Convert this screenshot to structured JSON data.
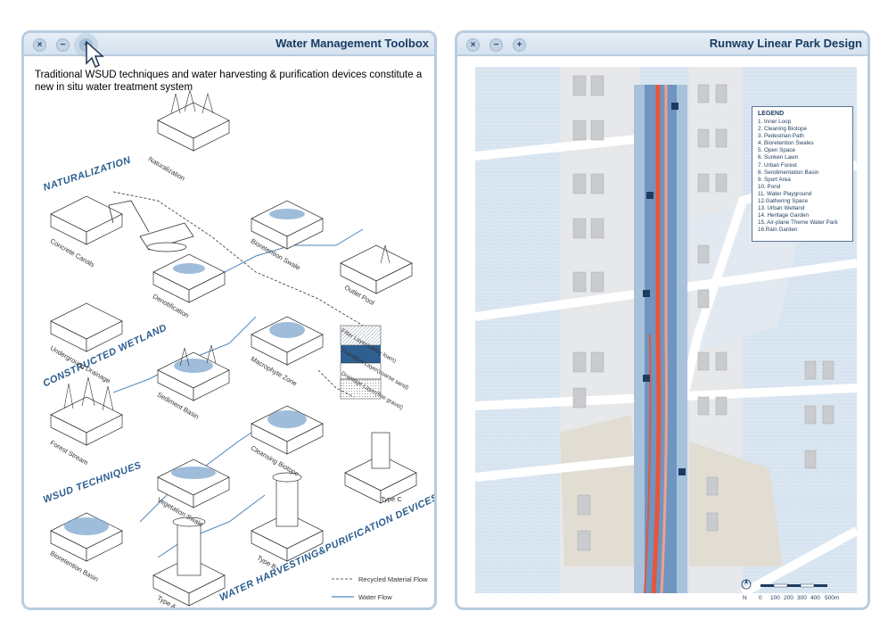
{
  "left_window": {
    "title": "Water Management Toolbox",
    "intro": "Traditional WSUD techniques and water harvesting & purification devices constitute a new in situ water treatment system",
    "sections": {
      "naturalization": "NATURALIZATION",
      "constructed_wetland": "CONSTRUCTED WETLAND",
      "wsud": "WSUD TECHNIQUES",
      "harvesting": "WATER HARVESTING&PURIFICATION DEVICES"
    },
    "blocks": {
      "naturalization": "Naturalization",
      "concrete_canals": "Concrete Canals",
      "bioretention_swale": "Bioretention Swale",
      "denotification": "Denotification",
      "outlet_pool": "Outlet Pool",
      "underground_drainage": "Underground Drainage",
      "macrophyte_zone": "Macrophyte Zone",
      "sediment_basin": "Sediment Basin",
      "forest_stream": "Forest Stream",
      "cleansing_biotope": "Cleansing Biotope",
      "vegetation_swale": "Vegetation Swale",
      "bioretention_basin": "Bioretention Basin",
      "type_a": "Type A",
      "type_b": "Type B",
      "type_c": "Type C"
    },
    "layers": {
      "filter": "Filter Layer(sandy loam)",
      "transition": "Transition Layer(coarse sand)",
      "drainage": "Drainage Layer(fine gravel)"
    },
    "legend": {
      "recycled": "Recycled Material Flow",
      "water": "Water Flow"
    }
  },
  "right_window": {
    "title": "Runway Linear Park Design",
    "legend_title": "LEGEND",
    "legend_items": [
      "1. Inner Loop",
      "2. Cleaning Biotope",
      "3. Pedestrian Path",
      "4. Bioretention Swales",
      "5. Open Space",
      "6. Sunken Lawn",
      "7. Urban Forest",
      "8. Sendimentation Basin",
      "9. Sport Area",
      "10. Pond",
      "11. Water Playground",
      "12.Gathering Space",
      "13. Urban Wetland",
      "14. Heritage Garden",
      "15. Air-plane Theme Water Park",
      "16.Rain Garden"
    ],
    "north": "N",
    "scale": [
      "0",
      "100",
      "200",
      "300",
      "400",
      "500m"
    ]
  },
  "controls": {
    "close": "×",
    "minimize": "−",
    "maximize": "+"
  },
  "colors": {
    "frame": "#b9cde0",
    "title": "#173b63",
    "accent_blue": "#2a5d8f",
    "runway_red": "#e8553d",
    "water_blue": "#8fb2d2"
  }
}
